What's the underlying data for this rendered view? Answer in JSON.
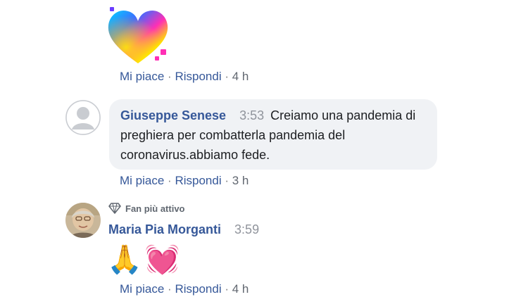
{
  "colors": {
    "link": "#365899",
    "muted": "#616770",
    "bubble_bg": "#f0f2f5",
    "text": "#1c1e21"
  },
  "comments": [
    {
      "sticker": "rainbow-heart-icon",
      "actions": {
        "like": "Mi piace",
        "sep": "·",
        "reply": "Rispondi",
        "time": "4 h"
      }
    },
    {
      "author": "Giuseppe Senese",
      "timestamp": "3:53",
      "text": "Creiamo una pandemia di preghiera per combatterla pandemia del coronavirus.abbiamo fede.",
      "actions": {
        "like": "Mi piace",
        "sep": "·",
        "reply": "Rispondi",
        "time": "3 h"
      }
    },
    {
      "badge": "Fan più attivo",
      "author": "Maria Pia Morganti",
      "timestamp": "3:59",
      "emoji": [
        "🙏",
        "💓"
      ],
      "actions": {
        "like": "Mi piace",
        "sep": "·",
        "reply": "Rispondi",
        "time": "4 h"
      }
    }
  ]
}
